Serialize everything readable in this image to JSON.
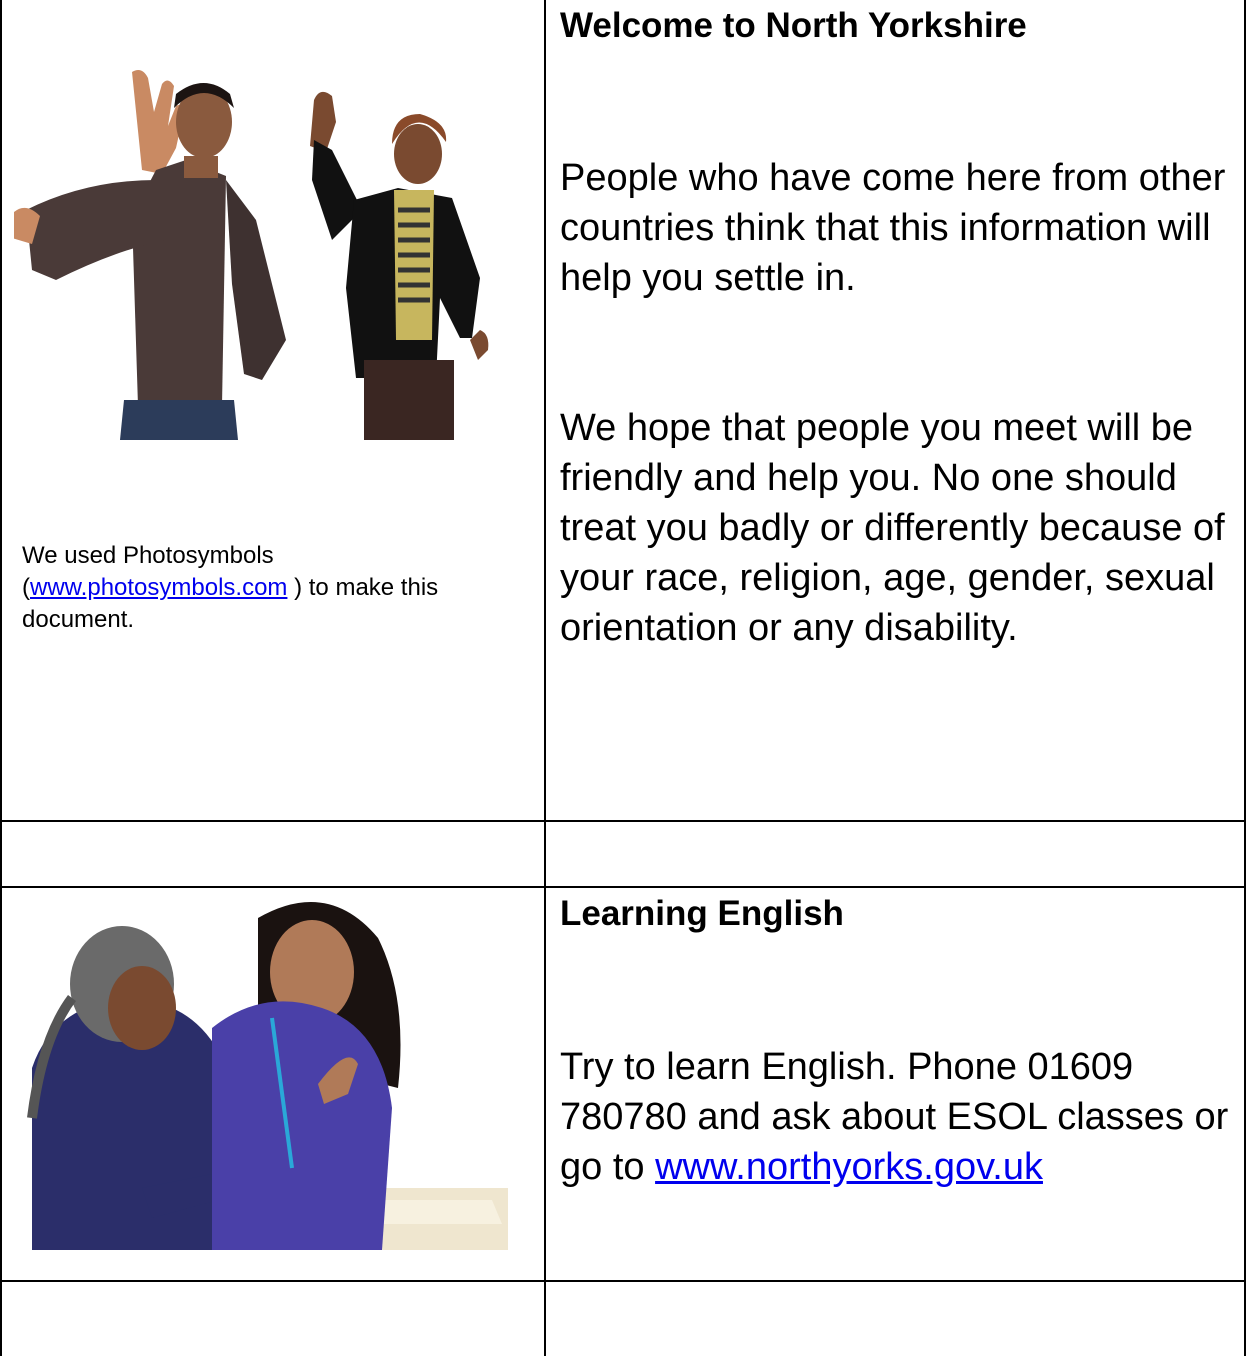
{
  "section1": {
    "heading": "Welcome to North Yorkshire",
    "para1": "People who have come here from other countries think that this information will help you settle in.",
    "para2": "We hope that people you meet will be friendly and help you.  No one should treat you badly or differently because of your race, religion, age, gender, sexual orientation or any disability.",
    "caption": {
      "before": "We used Photosymbols",
      "open_paren": "(",
      "link_text": "www.photosymbols.com",
      "after": " ) to make this document."
    }
  },
  "section2": {
    "heading": "Learning English",
    "para_text": "Try to learn English.  Phone 01609 780780 and ask  about ESOL classes or go to ",
    "link_text": "www.northyorks.gov.uk"
  },
  "colors": {
    "link": "#0000ee",
    "border": "#000000"
  }
}
